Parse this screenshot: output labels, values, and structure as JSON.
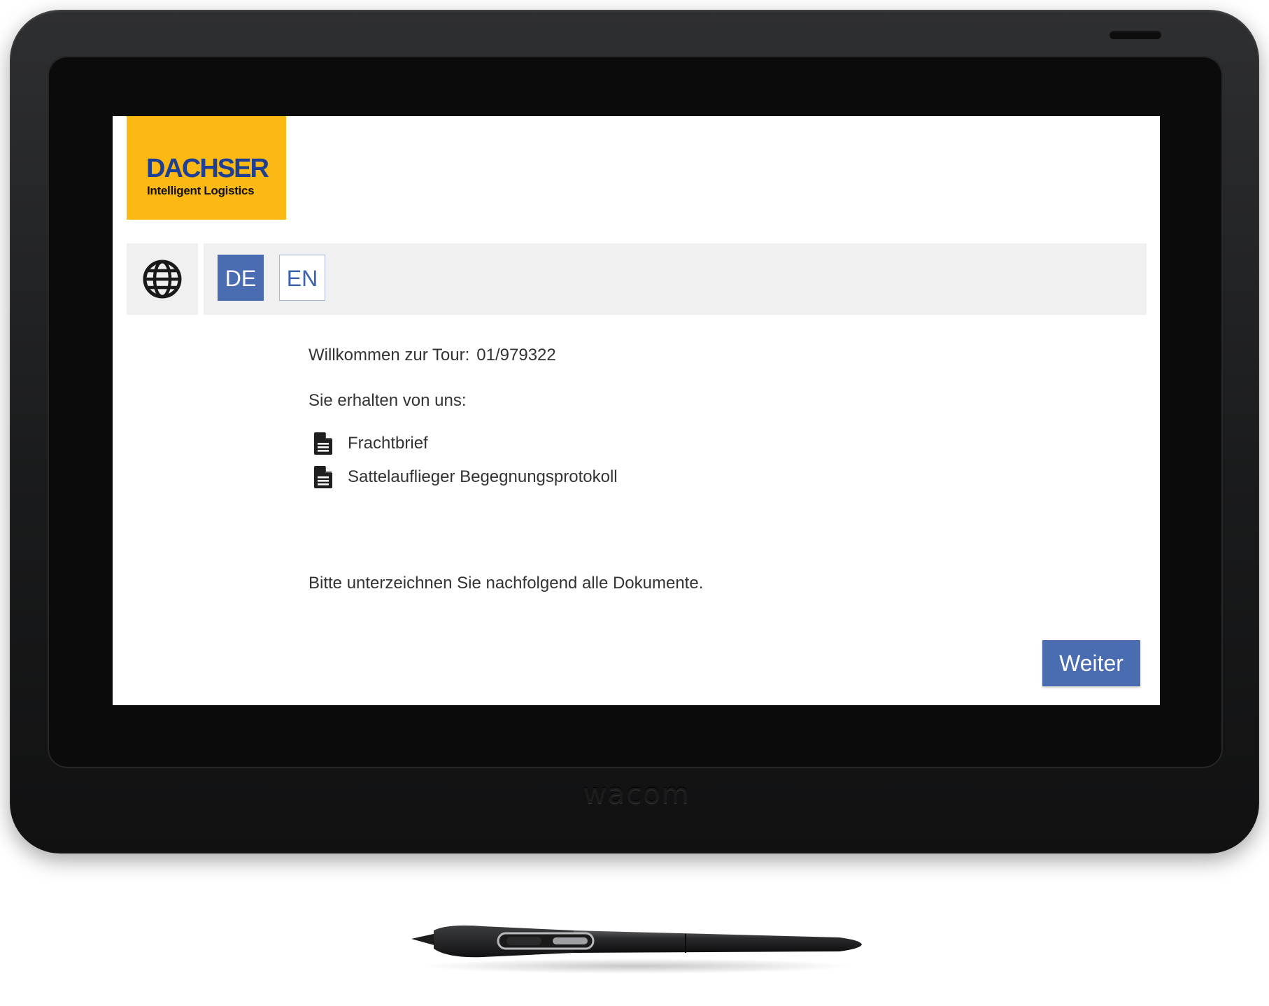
{
  "device": {
    "brand": "wacom"
  },
  "logo": {
    "title": "DACHSER",
    "subtitle": "Intelligent Logistics"
  },
  "language_bar": {
    "icon": "globe-icon",
    "options": [
      {
        "label": "DE",
        "selected": true
      },
      {
        "label": "EN",
        "selected": false
      }
    ]
  },
  "main": {
    "welcome_label": "Willkommen zur Tour:",
    "tour_number": "01/979322",
    "receive_label": "Sie erhalten von uns:",
    "documents": [
      {
        "label": "Frachtbrief",
        "icon": "document-icon"
      },
      {
        "label": "Sattelauflieger Begegnungsprotokoll",
        "icon": "document-icon"
      }
    ],
    "instruction": "Bitte unterzeichnen Sie nachfolgend alle Dokumente.",
    "next_button": "Weiter"
  },
  "colors": {
    "brand_yellow": "#fdb913",
    "brand_blue": "#1d3f94",
    "accent_blue": "#4a6cb0",
    "bar_gray": "#f0f0f0"
  }
}
